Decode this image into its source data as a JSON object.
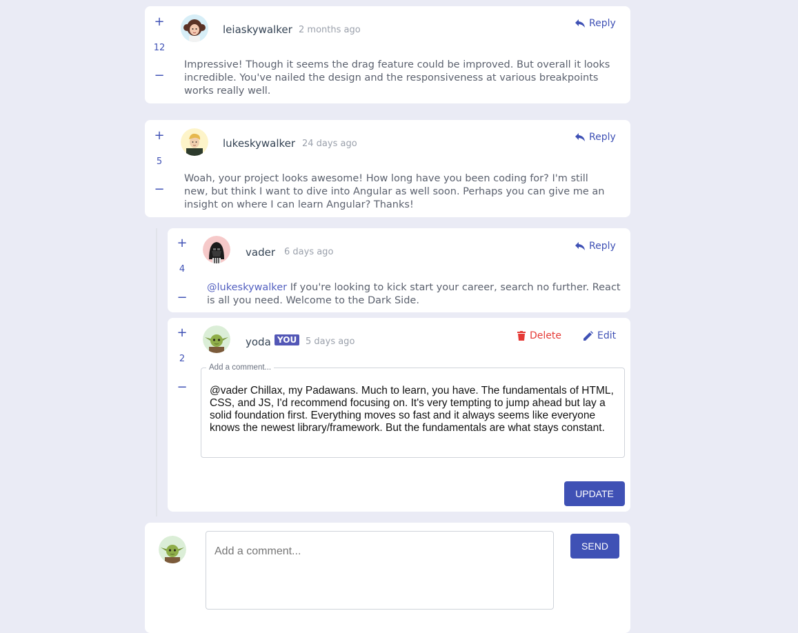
{
  "colors": {
    "accent": "#3f51b5",
    "delete": "#e53935",
    "background": "#eaebf5"
  },
  "comments": [
    {
      "username": "leiaskywalker",
      "time": "2 months ago",
      "score": "12",
      "reply_label": "Reply",
      "content": "Impressive! Though it seems the drag feature could be improved. But overall it looks incredible. You've nailed the design and the responsiveness at various breakpoints works really well."
    },
    {
      "username": "lukeskywalker",
      "time": "24 days ago",
      "score": "5",
      "reply_label": "Reply",
      "content": "Woah, your project looks awesome! How long have you been coding for? I'm still new, but think I want to dive into Angular as well soon. Perhaps you can give me an insight on where I can learn Angular? Thanks!"
    }
  ],
  "replies": [
    {
      "username": "vader",
      "time": "6 days ago",
      "score": "4",
      "reply_label": "Reply",
      "mention": "@lukeskywalker",
      "content": "If you're looking to kick start your career, search no further. React is all you need. Welcome to the Dark Side."
    }
  ],
  "editing": {
    "username": "yoda",
    "badge": "YOU",
    "time": "5 days ago",
    "score": "2",
    "delete_label": "Delete",
    "edit_label": "Edit",
    "field_label": "Add a comment...",
    "value": "@vader Chillax, my Padawans. Much to learn, you have. The fundamentals of HTML, CSS, and JS,  I'd recommend focusing on. It's very tempting to jump ahead but lay a solid foundation first. Everything moves so fast and it always seems like everyone knows the newest library/framework. But the fundamentals are what stays constant.",
    "update_label": "UPDATE"
  },
  "new_comment": {
    "placeholder": "Add a comment...",
    "send_label": "SEND"
  },
  "vote": {
    "plus": "+",
    "minus": "−"
  }
}
